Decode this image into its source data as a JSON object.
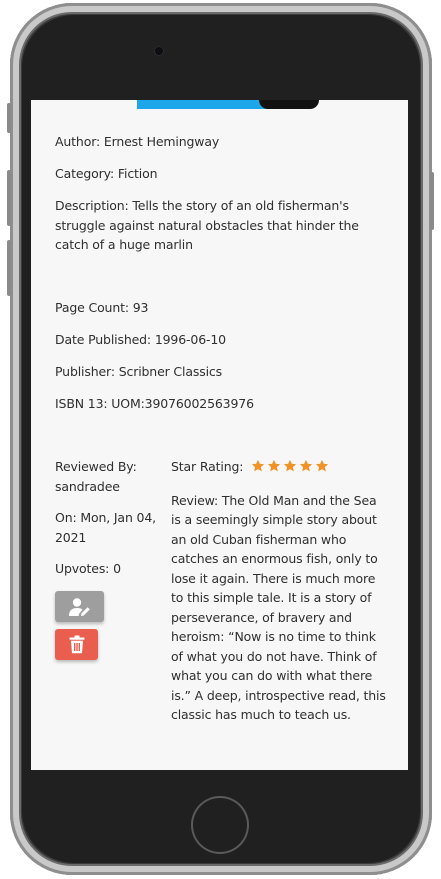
{
  "book": {
    "author": "Author: Ernest Hemingway",
    "category": "Category: Fiction",
    "description": "Description: Tells the story of an old fisherman's struggle against natural obstacles that hinder the catch of a huge marlin",
    "page_count": "Page Count: 93",
    "date_published": "Date Published: 1996-06-10",
    "publisher": "Publisher: Scribner Classics",
    "isbn": "ISBN 13: UOM:39076002563976"
  },
  "review": {
    "reviewed_by_label": "Reviewed By:",
    "reviewer": "sandradee",
    "date_line": "On: Mon, Jan 04, 2021",
    "upvotes": "Upvotes: 0",
    "star_rating_label": "Star Rating:",
    "rating": 5,
    "text": "Review: The Old Man and the Sea is a seemingly simple story about an old Cuban fisherman who catches an enormous fish, only to lose it again. There is much more to this simple tale. It is a story of perseverance, of bravery and heroism: “Now is no time to think of what you do not have. Think of what you can do with what there is.” A deep, introspective read, this classic has much to teach us."
  },
  "icons": {
    "edit": "edit-user-icon",
    "delete": "trash-icon",
    "star": "star-icon"
  },
  "colors": {
    "star": "#f0932b",
    "edit_button": "#9e9e9e",
    "delete_button": "#ea5e50",
    "cover_accent": "#1ea6ea"
  }
}
